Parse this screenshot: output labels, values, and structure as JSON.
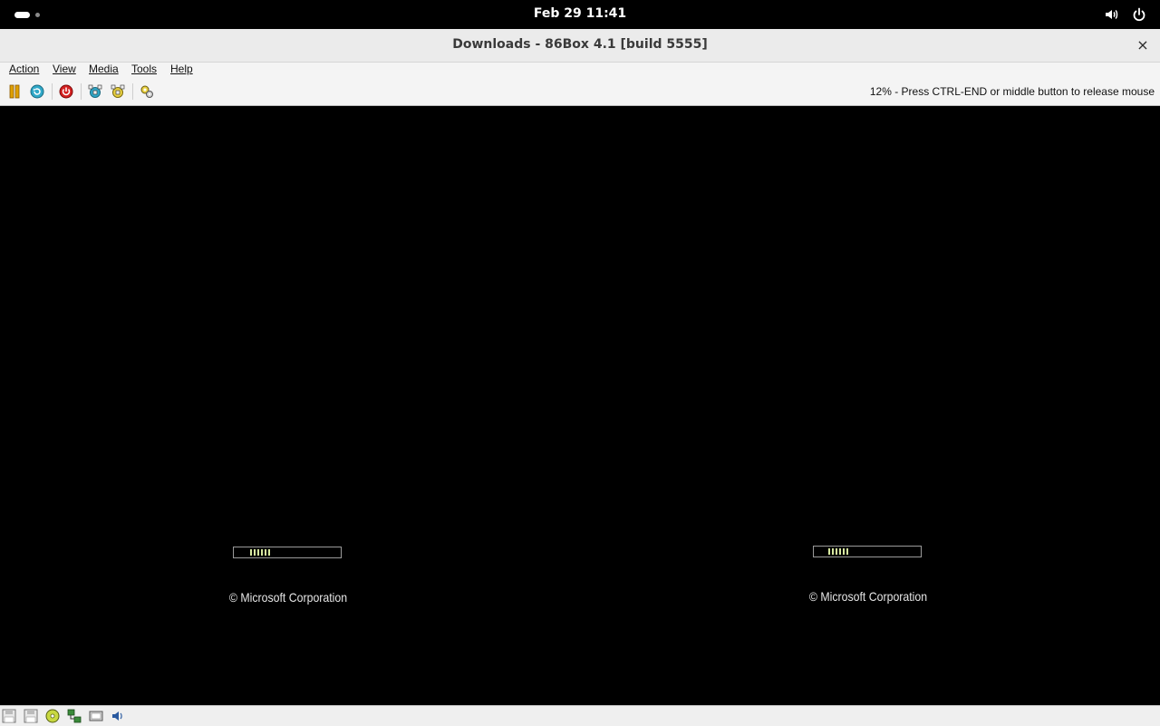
{
  "topbar": {
    "clock": "Feb 29  11:41",
    "icons": [
      "activities-indicator",
      "speaker-icon",
      "power-icon"
    ]
  },
  "window": {
    "title": "Downloads - 86Box 4.1 [build 5555]",
    "close_label": "×"
  },
  "menu": {
    "action": "Action",
    "view": "View",
    "media": "Media",
    "tools": "Tools",
    "help": "Help"
  },
  "toolbar": {
    "buttons": [
      "pause-icon",
      "reset-icon",
      "power-off-icon",
      "ctrl-alt-del-icon",
      "ctrl-alt-esc-icon",
      "settings-icon"
    ],
    "status_message": "12% - Press CTRL-END or middle button to release mouse"
  },
  "screen": {
    "left_copyright": "© Microsoft Corporation",
    "right_copyright": "© Microsoft Corporation",
    "boot_progress_color": "#d7e9a0"
  },
  "statusbar": {
    "icons": [
      "floppy-drive-1-icon",
      "floppy-drive-2-icon",
      "cdrom-icon",
      "network-icon",
      "display-icon",
      "sound-icon"
    ]
  },
  "colors": {
    "topbar_bg": "#000000",
    "titlebar_bg": "#ebebeb",
    "menubar_bg": "#f4f4f4",
    "screen_bg": "#000000"
  }
}
